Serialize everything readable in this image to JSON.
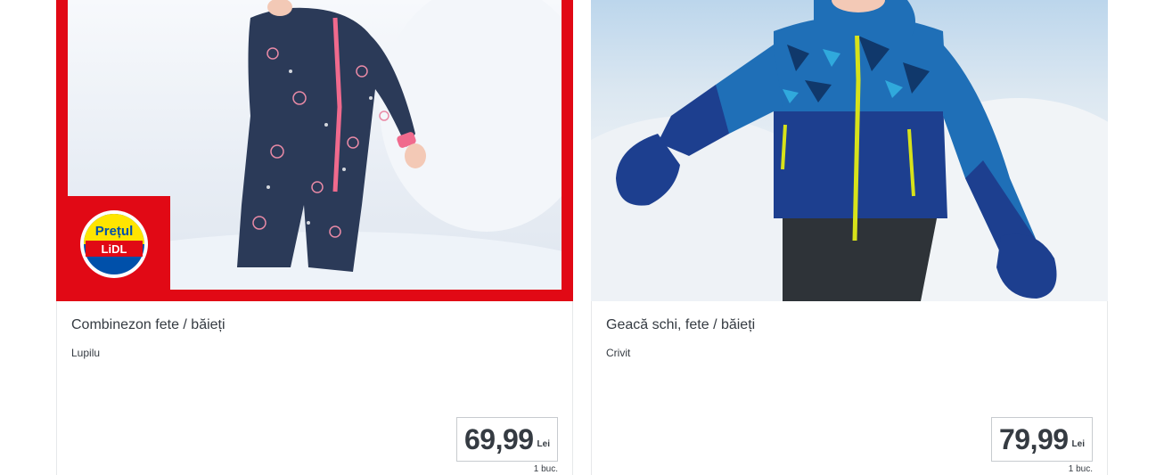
{
  "products": [
    {
      "title": "Combinezon fete / băieți",
      "brand": "Lupilu",
      "price": "69,99",
      "currency": "Lei",
      "unit": "1 buc.",
      "badge_line1": "Prețul",
      "badge_line2": "LiDL",
      "frame_color": "#e10915"
    },
    {
      "title": "Geacă schi, fete / băieți",
      "brand": "Crivit",
      "price": "79,99",
      "currency": "Lei",
      "unit": "1 buc."
    }
  ]
}
